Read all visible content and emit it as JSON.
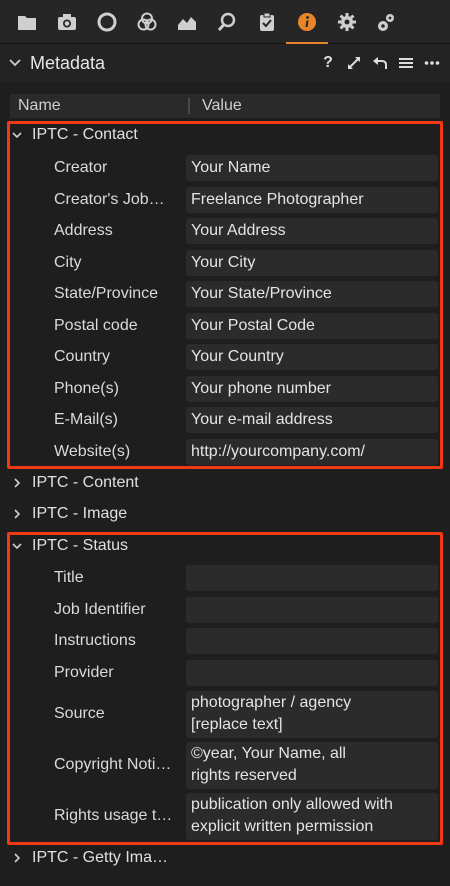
{
  "panel": {
    "title": "Metadata",
    "help": "?",
    "columns": {
      "name": "Name",
      "value": "Value"
    }
  },
  "toolbar": {
    "tabs": [
      "library-icon",
      "capture-icon",
      "lens-icon",
      "color-icon",
      "exposure-icon",
      "details-icon",
      "adjustments-icon",
      "metadata-info-icon",
      "settings-icon",
      "batch-icon"
    ],
    "active": "metadata-info-icon",
    "accent": "#e8852a"
  },
  "highlight_color": "#f03a17",
  "sections": {
    "contact": {
      "label": "IPTC - Contact",
      "rows": [
        {
          "label": "Creator",
          "value": "Your Name"
        },
        {
          "label": "Creator's Job…",
          "value": "Freelance Photographer"
        },
        {
          "label": "Address",
          "value": "Your Address"
        },
        {
          "label": "City",
          "value": "Your City"
        },
        {
          "label": "State/Province",
          "value": "Your State/Province"
        },
        {
          "label": "Postal code",
          "value": "Your Postal Code"
        },
        {
          "label": "Country",
          "value": "Your Country"
        },
        {
          "label": "Phone(s)",
          "value": "Your phone number"
        },
        {
          "label": "E-Mail(s)",
          "value": "Your e-mail address"
        },
        {
          "label": "Website(s)",
          "value": "http://yourcompany.com/"
        }
      ]
    },
    "content": {
      "label": "IPTC - Content"
    },
    "image": {
      "label": "IPTC - Image"
    },
    "status": {
      "label": "IPTC - Status",
      "rows": [
        {
          "label": "Title",
          "value": ""
        },
        {
          "label": "Job Identifier",
          "value": ""
        },
        {
          "label": "Instructions",
          "value": ""
        },
        {
          "label": "Provider",
          "value": ""
        },
        {
          "label": "Source",
          "value": "photographer / agency\n[replace text]"
        },
        {
          "label": "Copyright Noti…",
          "value": "©year, Your Name, all\nrights reserved"
        },
        {
          "label": "Rights usage t…",
          "value": "publication only allowed with\nexplicit written permission"
        }
      ]
    },
    "getty": {
      "label": "IPTC - Getty Ima…"
    }
  }
}
